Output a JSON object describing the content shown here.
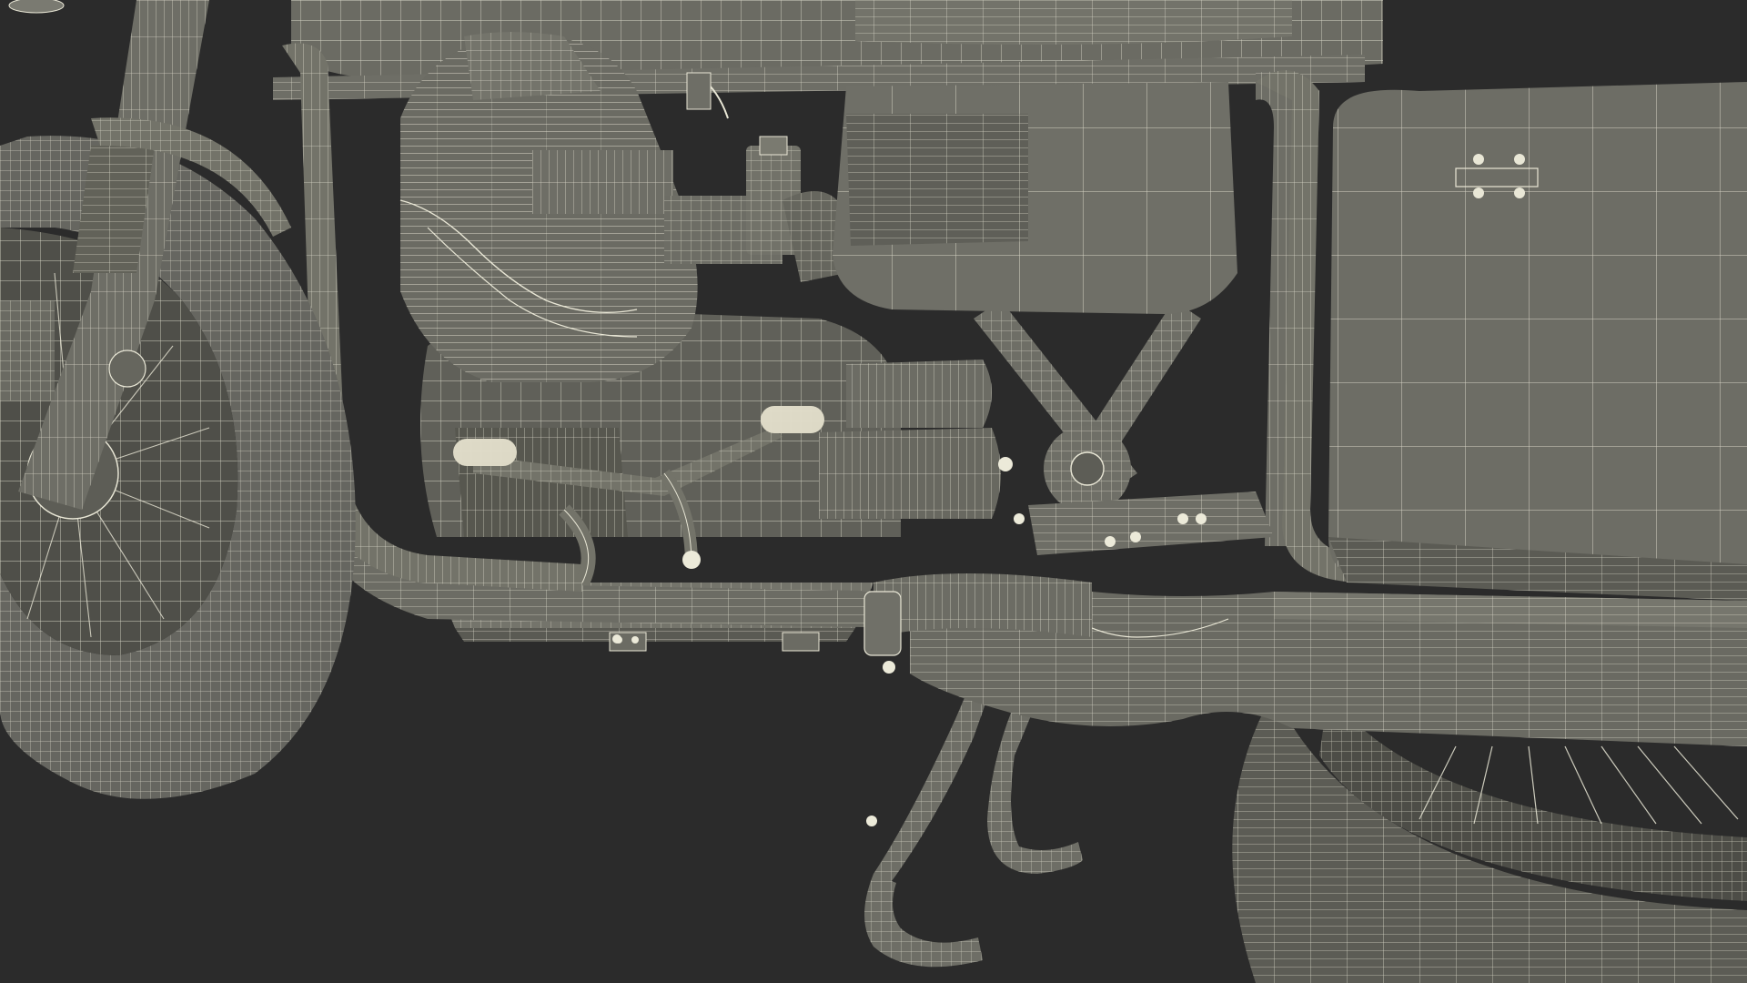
{
  "scene": {
    "subject": "motorcycle-wireframe-render",
    "background_color": "#2b2b2b",
    "mesh_fill": "#6b6b63",
    "mesh_fill_dark": "#55554e",
    "mesh_fill_light": "#7b7b72",
    "wire_color": "#e9e7d6",
    "highlight_color": "#f3f1e4"
  }
}
